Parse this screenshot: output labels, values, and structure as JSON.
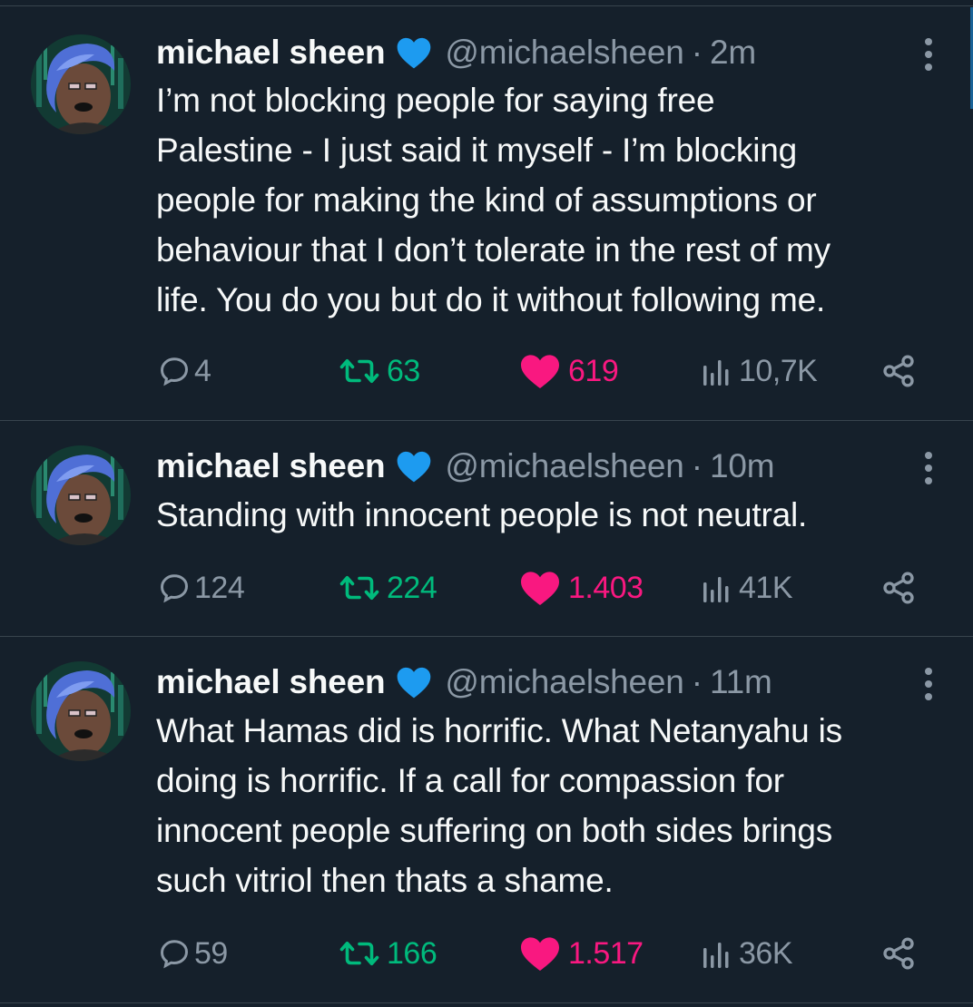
{
  "colors": {
    "background": "#15202b",
    "text": "#f7f9f9",
    "secondary": "#8b98a5",
    "verified": "#1d9bf0",
    "retweet": "#00ba7c",
    "like": "#f91880",
    "divider": "#38444d"
  },
  "tweets": [
    {
      "name": "michael sheen",
      "verified_icon": "verified-heart-icon",
      "handle": "@michaelsheen",
      "separator": "·",
      "time": "2m",
      "text": "I’m not blocking people for saying free\nPalestine - I just said it myself - I’m blocking\npeople for making the kind of assumptions or\nbehaviour that I don’t tolerate in the rest of my\nlife. You do you but do it without following me.",
      "replies": "4",
      "retweets": "63",
      "likes": "619",
      "liked": true,
      "retweeted": true,
      "views": "10,7K"
    },
    {
      "name": "michael sheen",
      "verified_icon": "verified-heart-icon",
      "handle": "@michaelsheen",
      "separator": "·",
      "time": "10m",
      "text": "Standing with innocent people is not neutral.",
      "replies": "124",
      "retweets": "224",
      "likes": "1.403",
      "liked": true,
      "retweeted": true,
      "views": "41K"
    },
    {
      "name": "michael sheen",
      "verified_icon": "verified-heart-icon",
      "handle": "@michaelsheen",
      "separator": "·",
      "time": "11m",
      "text": "What Hamas did is horrific. What Netanyahu is\ndoing is horrific. If a call for compassion for\ninnocent people suffering on both sides brings\nsuch vitriol then thats a shame.",
      "replies": "59",
      "retweets": "166",
      "likes": "1.517",
      "liked": true,
      "retweeted": true,
      "views": "36K"
    }
  ]
}
